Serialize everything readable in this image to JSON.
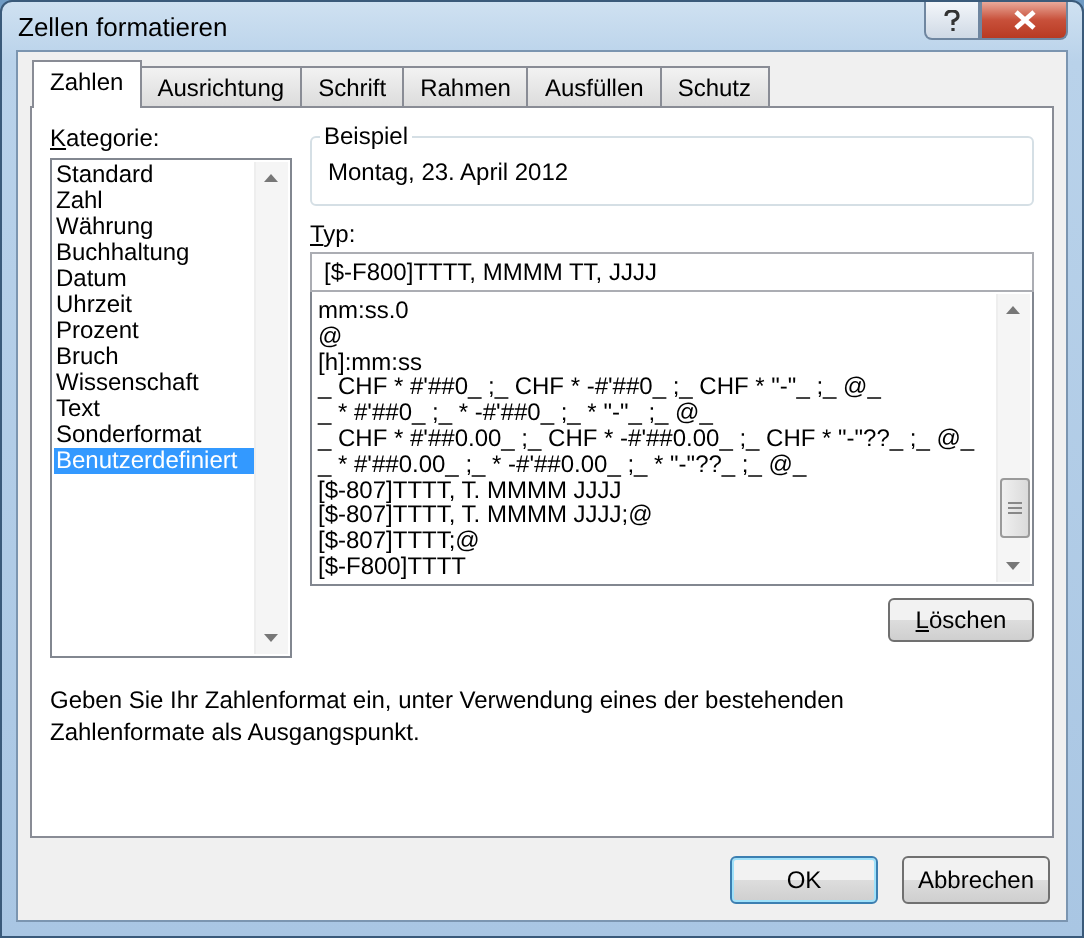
{
  "window": {
    "title": "Zellen formatieren"
  },
  "tabs": [
    {
      "label": "Zahlen",
      "selected": true
    },
    {
      "label": "Ausrichtung",
      "selected": false
    },
    {
      "label": "Schrift",
      "selected": false
    },
    {
      "label": "Rahmen",
      "selected": false
    },
    {
      "label": "Ausfüllen",
      "selected": false
    },
    {
      "label": "Schutz",
      "selected": false
    }
  ],
  "category": {
    "label": "Kategorie:",
    "items": [
      {
        "label": "Standard",
        "selected": false
      },
      {
        "label": "Zahl",
        "selected": false
      },
      {
        "label": "Währung",
        "selected": false
      },
      {
        "label": "Buchhaltung",
        "selected": false
      },
      {
        "label": "Datum",
        "selected": false
      },
      {
        "label": "Uhrzeit",
        "selected": false
      },
      {
        "label": "Prozent",
        "selected": false
      },
      {
        "label": "Bruch",
        "selected": false
      },
      {
        "label": "Wissenschaft",
        "selected": false
      },
      {
        "label": "Text",
        "selected": false
      },
      {
        "label": "Sonderformat",
        "selected": false
      },
      {
        "label": "Benutzerdefiniert",
        "selected": true
      }
    ]
  },
  "sample": {
    "label": "Beispiel",
    "value": "Montag, 23. April 2012"
  },
  "type": {
    "label": "Typ:",
    "value": "[$-F800]TTTT, MMMM TT, JJJJ",
    "items": [
      {
        "label": "mm:ss.0",
        "selected": false
      },
      {
        "label": "@",
        "selected": false
      },
      {
        "label": "[h]:mm:ss",
        "selected": false
      },
      {
        "label": "_ CHF * #'##0_ ;_ CHF * -#'##0_ ;_ CHF * \"-\"_ ;_ @_",
        "selected": false
      },
      {
        "label": "_ * #'##0_ ;_ * -#'##0_ ;_ * \"-\"_ ;_ @_",
        "selected": false
      },
      {
        "label": "_ CHF * #'##0.00_ ;_ CHF * -#'##0.00_ ;_ CHF * \"-\"??_ ;_ @_",
        "selected": false
      },
      {
        "label": "_ * #'##0.00_ ;_ * -#'##0.00_ ;_ * \"-\"??_ ;_ @_",
        "selected": false
      },
      {
        "label": "[$-807]TTTT, T. MMMM JJJJ",
        "selected": false
      },
      {
        "label": "[$-807]TTTT, T. MMMM JJJJ;@",
        "selected": false
      },
      {
        "label": "[$-807]TTTT;@",
        "selected": false
      },
      {
        "label": "[$-F800]TTTT",
        "selected": false
      }
    ]
  },
  "delete_button": "Löschen",
  "description": "Geben Sie Ihr Zahlenformat ein, unter Verwendung eines der bestehenden Zahlenformate als Ausgangspunkt.",
  "buttons": [
    {
      "label": "OK",
      "kind": "default"
    },
    {
      "label": "Abbrechen",
      "kind": "normal"
    }
  ]
}
